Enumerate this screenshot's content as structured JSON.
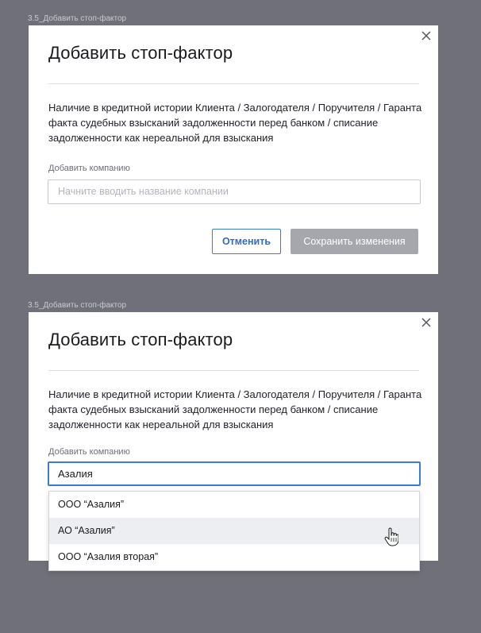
{
  "frames": [
    {
      "label": "3.5_Добавить стоп-фактор",
      "title": "Добавить стоп-фактор",
      "description": "Наличие в кредитной истории Клиента / Залогодателя / Поручителя / Гаранта факта судебных взысканий задолженности перед банком / списание задолженности как нереальной для взыскания",
      "field_label": "Добавить компанию",
      "input_placeholder": "Начните вводить название компании",
      "cancel_label": "Отменить",
      "save_label": "Сохранить изменения"
    },
    {
      "label": "3.5_Добавить стоп-фактор",
      "title": "Добавить стоп-фактор",
      "description": "Наличие в кредитной истории Клиента / Залогодателя / Поручителя / Гаранта факта судебных взысканий задолженности перед банком / списание задолженности как нереальной для взыскания",
      "field_label": "Добавить компанию",
      "input_value": "Азалия",
      "dropdown_options": [
        "ООО “Азалия”",
        "АО “Азалия”",
        "ООО “Азалия вторая”"
      ],
      "hovered_option": "АО “Азалия”"
    }
  ],
  "colors": {
    "backdrop": "#6f7079",
    "accent": "#3a7bd5",
    "disabled_button": "#a6a7ad",
    "hover_row": "#eceef2"
  }
}
